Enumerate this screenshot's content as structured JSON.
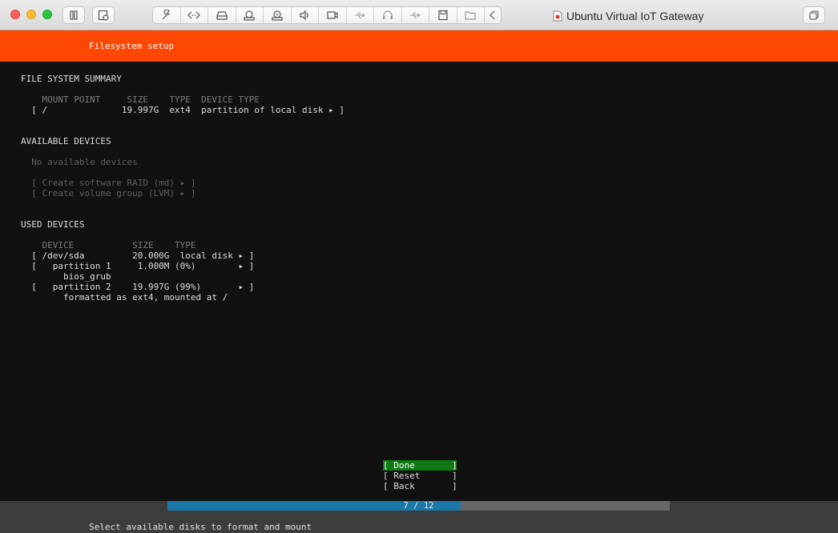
{
  "window": {
    "title": "Ubuntu Virtual IoT Gateway",
    "toolbar_icons": [
      "pause-icon",
      "snapshot-icon",
      "settings-wrench-icon",
      "code-icon",
      "drive-icon",
      "camera-icon",
      "hdd-icon",
      "sound-icon",
      "video-icon",
      "usb-icon",
      "headset-icon",
      "usb2-icon",
      "floppy-icon",
      "folder-icon",
      "collapse-chevron-icon"
    ]
  },
  "header": {
    "title": "Filesystem setup"
  },
  "summary": {
    "heading": "FILE SYSTEM SUMMARY",
    "columns": "    MOUNT POINT     SIZE    TYPE  DEVICE TYPE",
    "rows": [
      "  [ /              19.997G  ext4  partition of local disk ▸ ]"
    ]
  },
  "available": {
    "heading": "AVAILABLE DEVICES",
    "empty_text": "  No available devices",
    "actions": [
      "  [ Create software RAID (md) ▸ ]",
      "  [ Create volume group (LVM) ▸ ]"
    ]
  },
  "used": {
    "heading": "USED DEVICES",
    "columns": "    DEVICE           SIZE    TYPE",
    "rows": [
      "  [ /dev/sda         20.000G  local disk ▸ ]",
      "  [   partition 1     1.000M (0%)        ▸ ]",
      "        bios_grub",
      "  [   partition 2    19.997G (99%)       ▸ ]",
      "        formatted as ext4, mounted at /"
    ]
  },
  "buttons": {
    "done": "[ Done       ]",
    "reset": "[ Reset      ]",
    "back": "[ Back       ]"
  },
  "progress": {
    "label": "7 / 12",
    "value": 0.583
  },
  "footer": {
    "help_text": "Select available disks to format and mount"
  },
  "colors": {
    "header": "#fd4703",
    "done_button": "#0f7a13",
    "progress_fill": "#1c78a8"
  }
}
